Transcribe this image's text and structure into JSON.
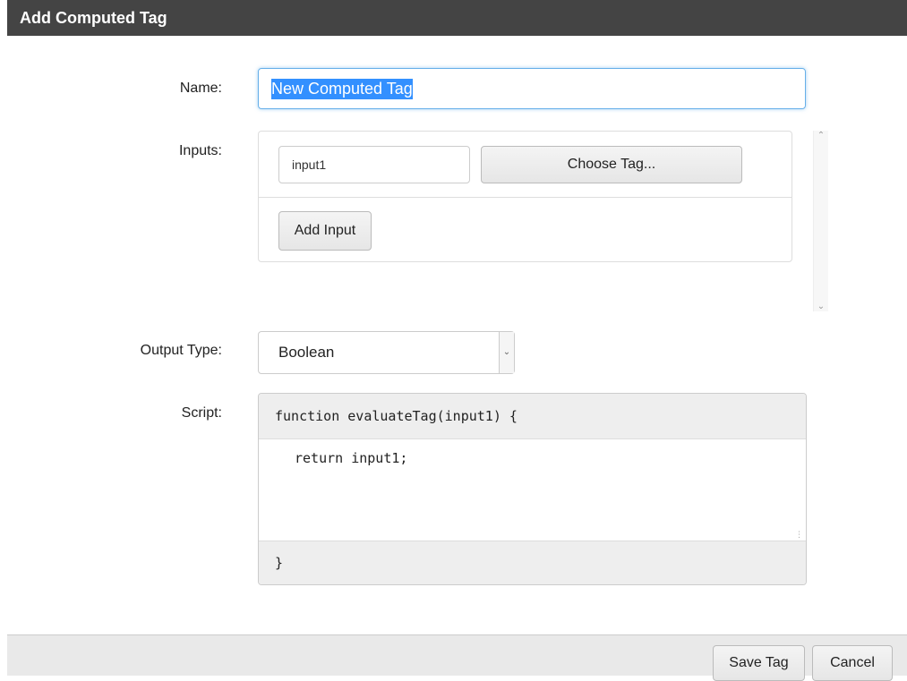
{
  "dialog": {
    "title": "Add Computed Tag"
  },
  "form": {
    "name_label": "Name:",
    "name_value": "New Computed Tag",
    "inputs_label": "Inputs:",
    "inputs": [
      {
        "name": "input1",
        "choose_label": "Choose Tag..."
      }
    ],
    "add_input_label": "Add Input",
    "output_type_label": "Output Type:",
    "output_type_value": "Boolean",
    "script_label": "Script:",
    "script_header": "function evaluateTag(input1) {",
    "script_body": "return input1;",
    "script_footer": "}"
  },
  "footer": {
    "save_label": "Save Tag",
    "cancel_label": "Cancel"
  },
  "icons": {
    "scroll_up": "chevron-up-icon",
    "scroll_down": "chevron-down-icon",
    "select_arrow": "chevron-down-icon",
    "resize": "resize-grip-icon"
  },
  "colors": {
    "titlebar": "#444444",
    "selection": "#3390ff",
    "focus_border": "#66afe9"
  }
}
